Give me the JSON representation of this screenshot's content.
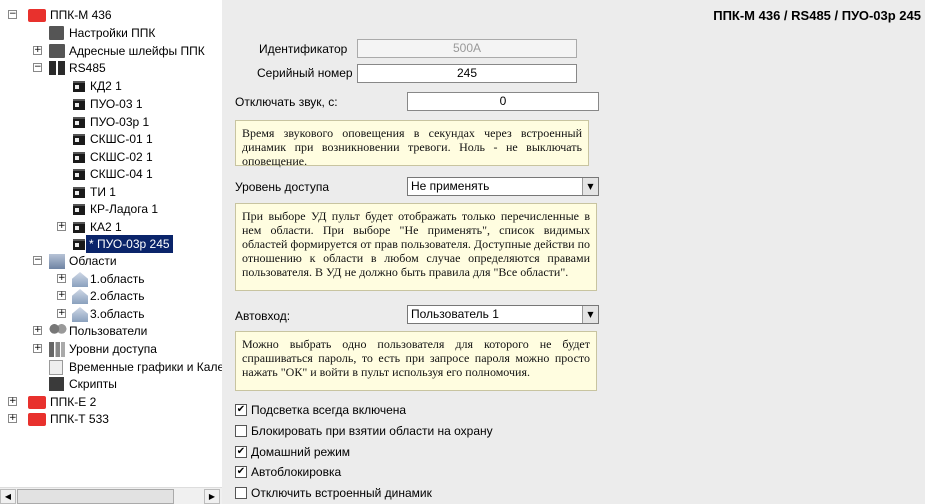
{
  "tree": {
    "root1": {
      "label": "ППК-М 436"
    },
    "settings": {
      "label": "Настройки ППК"
    },
    "address_loops": {
      "label": "Адресные шлейфы ППК"
    },
    "rs485": {
      "label": "RS485"
    },
    "devices": [
      {
        "label": "КД2 1"
      },
      {
        "label": "ПУО-03 1"
      },
      {
        "label": "ПУО-03р 1"
      },
      {
        "label": "СКШС-01 1"
      },
      {
        "label": "СКШС-02 1"
      },
      {
        "label": "СКШС-04 1"
      },
      {
        "label": "ТИ 1"
      },
      {
        "label": "КР-Ладога 1"
      },
      {
        "label": "КА2 1"
      },
      {
        "label": "* ПУО-03р 245"
      }
    ],
    "areas": {
      "label": "Области"
    },
    "area_items": [
      {
        "label": "1.область"
      },
      {
        "label": "2.область"
      },
      {
        "label": "3.область"
      }
    ],
    "users": {
      "label": "Пользователи"
    },
    "access_levels": {
      "label": "Уровни доступа"
    },
    "schedules": {
      "label": "Временные графики и Кале"
    },
    "scripts": {
      "label": "Скрипты"
    },
    "root2": {
      "label": "ППК-Е 2"
    },
    "root3": {
      "label": "ППК-Т 533"
    }
  },
  "panel": {
    "breadcrumb": "ППК-М 436 / RS485 / ПУО-03р 245",
    "identifier": {
      "label": "Идентификатор",
      "value": "500A"
    },
    "serial": {
      "label": "Серийный номер",
      "value": "245"
    },
    "mute": {
      "label": "Отключать звук, с:",
      "value": "0"
    },
    "mute_note": "Время звукового оповещения в секундах через встроенный динамик при возникновении тревоги. Ноль - не выключать оповещение.",
    "access": {
      "label": "Уровень доступа",
      "value": "Не применять"
    },
    "access_note": "При выборе УД пульт будет отображать только перечисленные в нем области. При выборе \"Не применять\", список видимых областей формируется от прав пользователя. Доступные действи по отношению к области в любом случае определяются правами пользователя. В УД не должно быть правила для \"Все области\".",
    "autologin": {
      "label": "Автовход:",
      "value": "Пользователь 1"
    },
    "autologin_note": "Можно выбрать одно пользователя для которого не будет спрашиваться пароль, то есть при запросе пароля можно просто нажать \"ОК\" и войти в пульт используя его полномочия.",
    "checkboxes": [
      {
        "label": "Подсветка всегда включена",
        "checked": true,
        "mark": "✔"
      },
      {
        "label": "Блокировать при взятии области на охрану",
        "checked": false,
        "mark": ""
      },
      {
        "label": "Домашний режим",
        "checked": true,
        "mark": "✔"
      },
      {
        "label": "Автоблокировка",
        "checked": true,
        "mark": "✔"
      },
      {
        "label": "Отключить встроенный динамик",
        "checked": false,
        "mark": ""
      }
    ]
  },
  "colors": {
    "selection": "#0a246a",
    "panel_bg": "#ececec",
    "note_bg": "#fffde0",
    "device_red": "#e8312d"
  }
}
